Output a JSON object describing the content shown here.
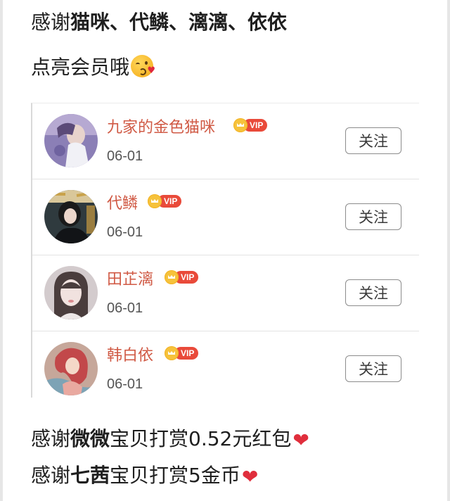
{
  "post": {
    "line1": {
      "prefix": "感谢",
      "names": "猫咪、代鳞、漓漓、依依"
    },
    "line2": {
      "text": "点亮会员哦",
      "emoji": "kissing-face-emoji"
    },
    "line3": {
      "prefix": "感谢",
      "name": "微微",
      "suffix": "宝贝打赏0.52元红包",
      "emoji": "red-heart"
    },
    "line4": {
      "prefix": "感谢",
      "name": "七茜",
      "suffix": "宝贝打赏5金币",
      "emoji": "red-heart"
    }
  },
  "followers": [
    {
      "name": "九家的金色猫咪",
      "badge": "VIP",
      "date": "06-01",
      "button": "关注",
      "avatar": "avatar-photo"
    },
    {
      "name": "代鳞",
      "badge": "VIP",
      "date": "06-01",
      "button": "关注",
      "avatar": "avatar-photo"
    },
    {
      "name": "田芷漓",
      "badge": "VIP",
      "date": "06-01",
      "button": "关注",
      "avatar": "avatar-photo"
    },
    {
      "name": "韩白依",
      "badge": "VIP",
      "date": "06-01",
      "button": "关注",
      "avatar": "avatar-illustration"
    }
  ],
  "colors": {
    "name": "#d05a45",
    "vip_badge": "#e94a3a",
    "crown": "#f6c23b",
    "heart": "#e02e3c"
  }
}
